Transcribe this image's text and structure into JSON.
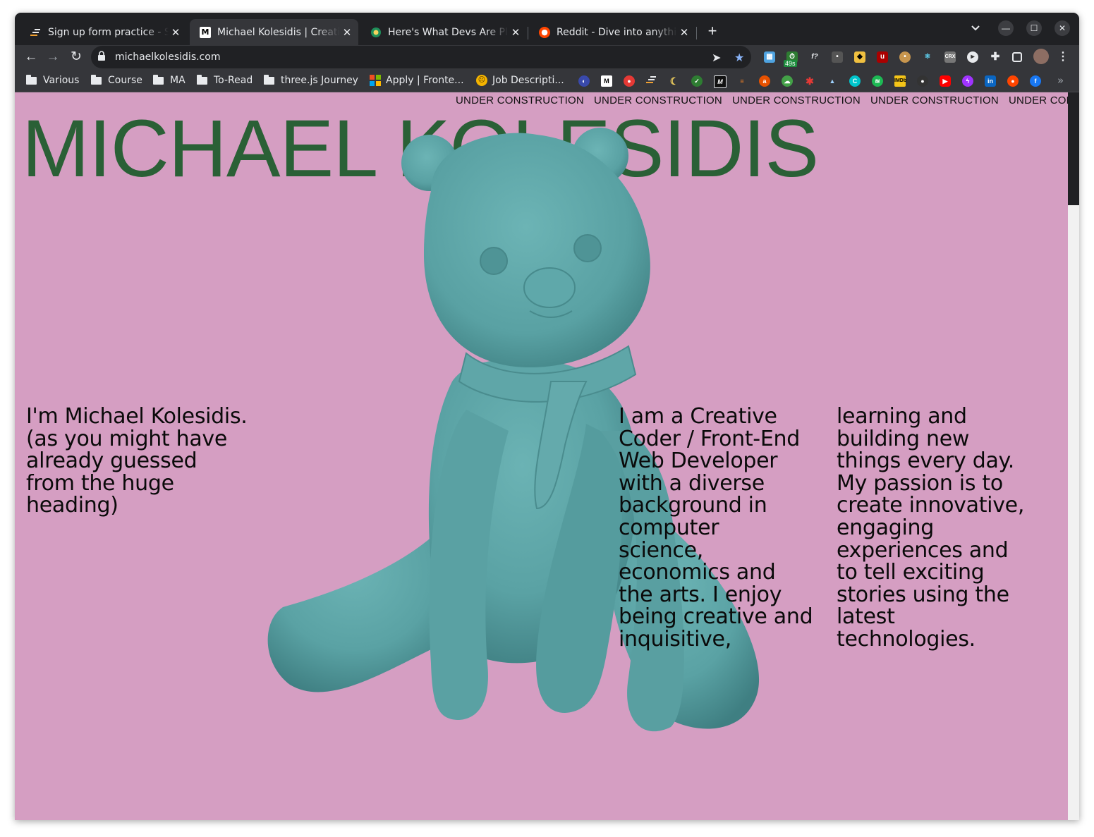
{
  "browser": {
    "tabs": [
      {
        "title": "Sign up form practice - Scrimba",
        "active": false,
        "favicon": "scrimba-icon"
      },
      {
        "title": "Michael Kolesidis | Creative Coder",
        "active": true,
        "favicon": "m-logo-icon"
      },
      {
        "title": "Here's What Devs Are Planning",
        "active": false,
        "favicon": "globe-icon"
      },
      {
        "title": "Reddit - Dive into anything",
        "active": false,
        "favicon": "reddit-icon"
      }
    ],
    "new_tab_symbol": "+",
    "close_symbol": "✕",
    "address": "michaelkolesidis.com",
    "extension_badge": "49s",
    "bookmarks": [
      {
        "label": "Various",
        "type": "folder"
      },
      {
        "label": "Course",
        "type": "folder"
      },
      {
        "label": "MA",
        "type": "folder"
      },
      {
        "label": "To-Read",
        "type": "folder"
      },
      {
        "label": "three.js Journey",
        "type": "folder"
      },
      {
        "label": "Apply | Fronte...",
        "type": "link",
        "icon": "microsoft-icon"
      },
      {
        "label": "Job Descripti...",
        "type": "link",
        "icon": "smiley-icon"
      }
    ],
    "more_bookmarks": "»"
  },
  "page": {
    "marquee": [
      "UNDER CONSTRUCTION",
      "UNDER CONSTRUCTION",
      "UNDER CONSTRUCTION",
      "UNDER CONSTRUCTION",
      "UNDER CON"
    ],
    "hero_title": "MICHAEL KOLESIDIS",
    "intro": [
      "I'm Michael Kolesidis.",
      "(as you might have",
      "already guessed",
      "from the huge",
      "heading)"
    ],
    "about_col1": [
      "I am a Creative",
      "Coder / Front-End",
      "Web Developer",
      "with a diverse",
      "background in",
      "computer",
      "science,",
      "economics and",
      "the arts. I enjoy",
      "being creative and",
      "inquisitive,"
    ],
    "about_col2": [
      "learning and",
      "building new",
      "things every day.",
      "My passion is to",
      "create innovative,",
      "engaging",
      "experiences and",
      "to tell exciting",
      "stories using the",
      "latest",
      "technologies."
    ],
    "colors": {
      "background": "#d59ec2",
      "title": "#2a6036",
      "bear": "#5fa6a8"
    }
  }
}
